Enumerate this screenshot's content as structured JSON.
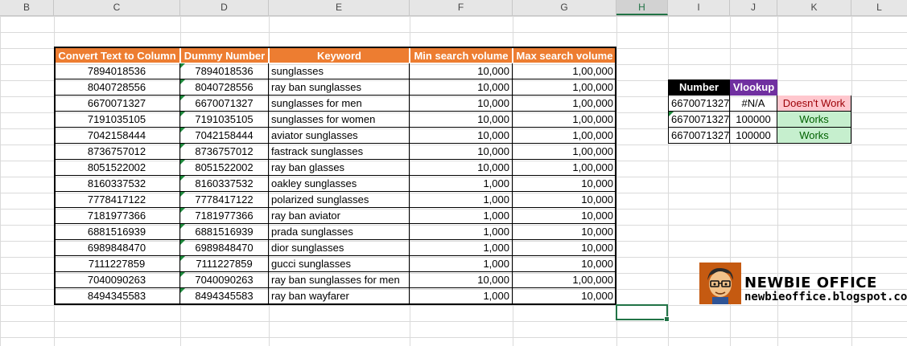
{
  "columns": [
    "B",
    "C",
    "D",
    "E",
    "F",
    "G",
    "H",
    "I",
    "J",
    "K",
    "L"
  ],
  "selected_column": "H",
  "table": {
    "headers": [
      "Convert Text to Column",
      "Dummy Number",
      "Keyword",
      "Min search volume",
      "Max search volume"
    ],
    "rows": [
      [
        "7894018536",
        "7894018536",
        "sunglasses",
        "10,000",
        "1,00,000"
      ],
      [
        "8040728556",
        "8040728556",
        "ray ban sunglasses",
        "10,000",
        "1,00,000"
      ],
      [
        "6670071327",
        "6670071327",
        "sunglasses for men",
        "10,000",
        "1,00,000"
      ],
      [
        "7191035105",
        "7191035105",
        "sunglasses for women",
        "10,000",
        "1,00,000"
      ],
      [
        "7042158444",
        "7042158444",
        "aviator sunglasses",
        "10,000",
        "1,00,000"
      ],
      [
        "8736757012",
        "8736757012",
        "fastrack sunglasses",
        "10,000",
        "1,00,000"
      ],
      [
        "8051522002",
        "8051522002",
        "ray ban glasses",
        "10,000",
        "1,00,000"
      ],
      [
        "8160337532",
        "8160337532",
        "oakley sunglasses",
        "1,000",
        "10,000"
      ],
      [
        "7778417122",
        "7778417122",
        "polarized sunglasses",
        "1,000",
        "10,000"
      ],
      [
        "7181977366",
        "7181977366",
        "ray ban aviator",
        "1,000",
        "10,000"
      ],
      [
        "6881516939",
        "6881516939",
        "prada sunglasses",
        "1,000",
        "10,000"
      ],
      [
        "6989848470",
        "6989848470",
        "dior sunglasses",
        "1,000",
        "10,000"
      ],
      [
        "7111227859",
        "7111227859",
        "gucci sunglasses",
        "1,000",
        "10,000"
      ],
      [
        "7040090263",
        "7040090263",
        "ray ban sunglasses for men",
        "10,000",
        "1,00,000"
      ],
      [
        "8494345583",
        "8494345583",
        "ray ban wayfarer",
        "1,000",
        "10,000"
      ]
    ]
  },
  "lookup": {
    "headers": [
      "Number",
      "Vlookup"
    ],
    "rows": [
      [
        "6670071327",
        "#N/A",
        "Doesn't Work"
      ],
      [
        "6670071327",
        "100000",
        "Works"
      ],
      [
        "6670071327",
        "100000",
        "Works"
      ]
    ]
  },
  "brand": {
    "title": "NEWBIE OFFICE",
    "url": "newbieoffice.blogspot.com"
  },
  "colors": {
    "header_orange": "#ed7d31",
    "vlookup_purple": "#7030a0",
    "bad_fill": "#ffc7ce",
    "good_fill": "#c6efce",
    "selection_green": "#217346"
  }
}
